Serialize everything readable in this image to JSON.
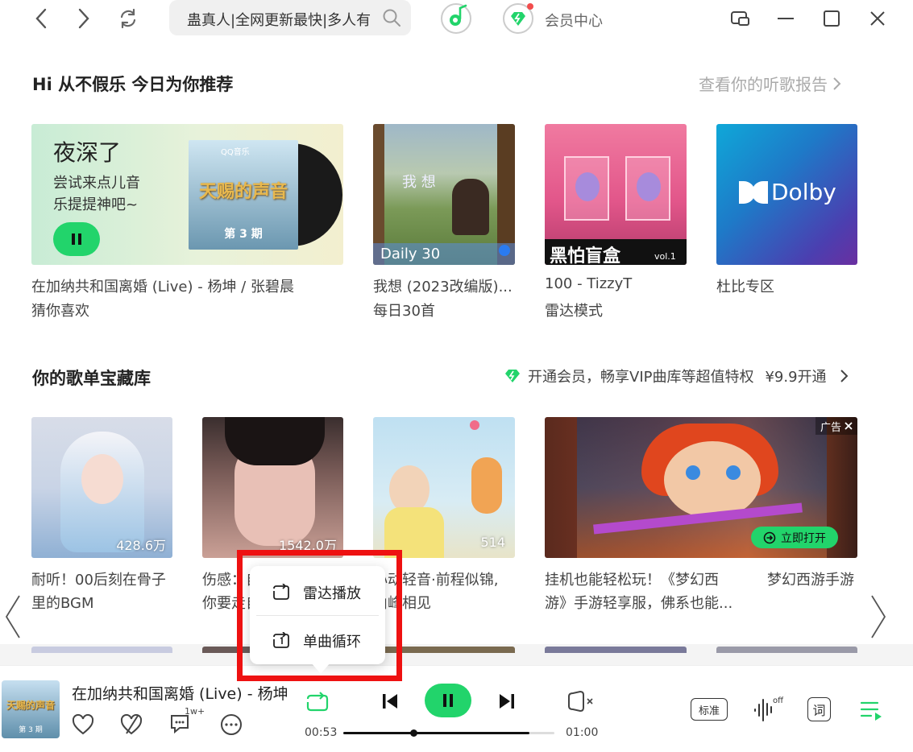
{
  "search": {
    "text": "蛊真人|全网更新最快|多人有"
  },
  "vip": {
    "label": "会员中心"
  },
  "recommend": {
    "title": "Hi 从不假乐 今日为你推荐",
    "report_link": "查看你的听歌报告",
    "feature": {
      "headline": "夜深了",
      "sub1": "尝试来点儿音",
      "sub2": "乐提提神吧~",
      "album_brand": "QQ音乐",
      "album_title": "天赐的声音",
      "album_episode": "第 3 期",
      "line1": "在加纳共和国离婚 (Live) - 杨坤 / 张碧晨",
      "line2": "猜你喜欢"
    },
    "cards": [
      {
        "badge": "Daily 30",
        "art_text": "我 想",
        "line1": "我想 (2023改编版)...",
        "line2": "每日30首"
      },
      {
        "art_text": "黑怕盲盒",
        "art_vol": "vol.1",
        "line1": "100 - TizzyT",
        "line2": "雷达模式"
      },
      {
        "art_text": "Dolby",
        "line1": "杜比专区",
        "line2": ""
      }
    ]
  },
  "playlists": {
    "title": "你的歌单宝藏库",
    "promo_text": "开通会员，畅享VIP曲库等超值特权",
    "promo_price": "¥9.9开通",
    "items": [
      {
        "count": "428.6万",
        "line1": "耐听！00后刻在骨子",
        "line2": "里的BGM"
      },
      {
        "count": "1542.0万",
        "line1": "伤感：自",
        "line2": "你要走自"
      },
      {
        "count": "514",
        "line1": "心动轻音·前程似锦,",
        "line2": "山峰相见"
      }
    ],
    "ad": {
      "badge": "广告",
      "open_label": "立即打开",
      "line1": "挂机也能轻松玩！《梦幻西",
      "line2": "游》手游轻享服，佛系也能...",
      "brand": "梦幻西游手游"
    }
  },
  "popup": {
    "items": [
      {
        "label": "雷达播放"
      },
      {
        "label": "单曲循环"
      }
    ]
  },
  "player": {
    "art_text": "天赐的声音",
    "art_episode": "第 3 期",
    "song": "在加纳共和国离婚 (Live) - 杨坤 / 张碧晨",
    "comment_badge": "1w+",
    "time_current": "00:53",
    "time_total": "01:00",
    "progress": 0.88,
    "quality_label": "标准",
    "effect_badge": "off",
    "lyric_label": "词",
    "accent": "#22d46b"
  }
}
